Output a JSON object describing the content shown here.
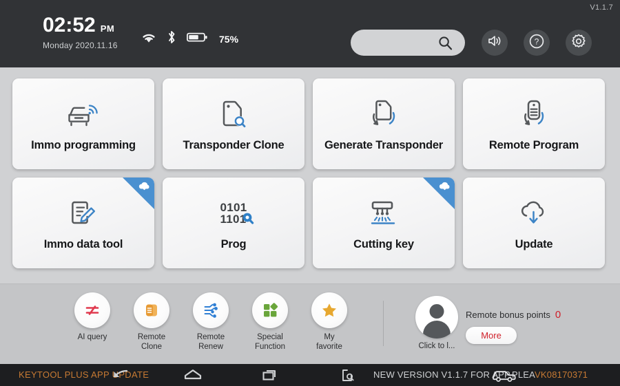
{
  "header": {
    "version": "V1.1.7",
    "time": "02:52",
    "ampm": "PM",
    "date": "Monday 2020.11.16",
    "battery_percent": "75%",
    "search_placeholder": "",
    "search_value": "",
    "icons": {
      "wifi": "wifi-icon",
      "bluetooth": "bluetooth-icon",
      "battery": "battery-icon",
      "search": "search-icon",
      "sound": "sound-icon",
      "help": "help-icon",
      "settings": "gear-icon"
    }
  },
  "main": {
    "tiles": [
      {
        "label": "Immo programming",
        "icon": "car-signal-icon",
        "badge": false
      },
      {
        "label": "Transponder Clone",
        "icon": "tag-search-icon",
        "badge": false
      },
      {
        "label": "Generate Transponder",
        "icon": "tag-refresh-icon",
        "badge": false
      },
      {
        "label": "Remote Program",
        "icon": "remote-refresh-icon",
        "badge": false
      },
      {
        "label": "Immo data tool",
        "icon": "document-edit-icon",
        "badge": true,
        "badge_icon": "cloud-download-icon"
      },
      {
        "label": "Prog",
        "icon": "binary-search-icon",
        "badge": false,
        "binary_top": "0101",
        "binary_bottom": "1101"
      },
      {
        "label": "Cutting key",
        "icon": "key-cutter-icon",
        "badge": true,
        "badge_icon": "cloud-download-icon"
      },
      {
        "label": "Update",
        "icon": "cloud-download-icon",
        "badge": false
      }
    ]
  },
  "dock": {
    "apps": [
      {
        "label": "AI query",
        "icon": "ai-query-icon",
        "color": "#e03a4e"
      },
      {
        "label": "Remote Clone",
        "icon": "remote-clone-icon",
        "color": "#e79a33"
      },
      {
        "label": "Remote Renew",
        "icon": "remote-renew-icon",
        "color": "#2f7fd4"
      },
      {
        "label": "Special Function",
        "icon": "special-function-icon",
        "color": "#6aa63b"
      },
      {
        "label": "My favorite",
        "icon": "star-icon",
        "color": "#e7a830"
      }
    ],
    "avatar_label": "Click to l...",
    "bonus_label": "Remote bonus points",
    "bonus_value": "0",
    "more_label": "More"
  },
  "navbar": {
    "marquee_left": "KEYTOOL PLUS APP UPDATE",
    "marquee_right_plain": "NEW VERSION V1.1.7 FOR APP,PLEA",
    "marquee_right_highlight": "VK08170371",
    "icons": {
      "back": "back-arrow-icon",
      "home": "home-icon",
      "recent": "recent-apps-icon",
      "screenshot": "screenshot-icon",
      "car": "car-icon"
    }
  },
  "colors": {
    "header_bg": "#313336",
    "page_bg": "#d0d1d3",
    "dock_bg": "#c4c5c7",
    "nav_bg": "#1d1e20",
    "accent_blue": "#4a90d0",
    "accent_orange": "#c77a33",
    "accent_red": "#d0202a"
  }
}
